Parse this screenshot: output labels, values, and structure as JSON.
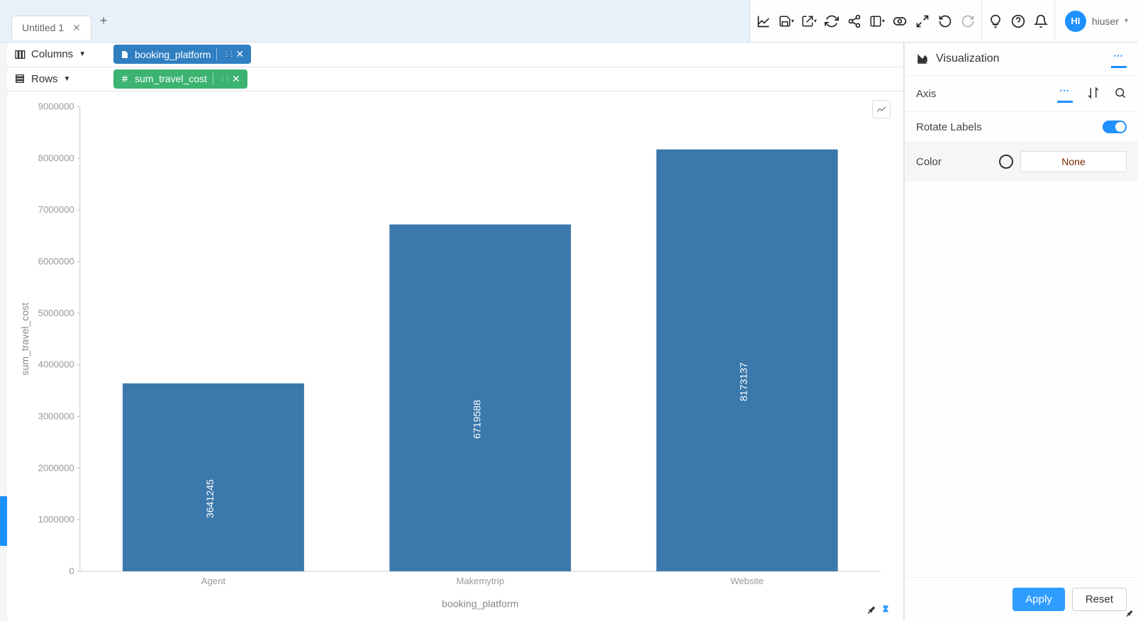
{
  "tab": {
    "title": "Untitled 1"
  },
  "user": {
    "initials": "HI",
    "name": "hiuser"
  },
  "shelves": {
    "columns_label": "Columns",
    "rows_label": "Rows",
    "column_pill": "booking_platform",
    "row_pill": "sum_travel_cost"
  },
  "viz_panel": {
    "title": "Visualization",
    "axis_label": "Axis",
    "rotate_label": "Rotate Labels",
    "color_label": "Color",
    "color_value": "None",
    "apply": "Apply",
    "reset": "Reset"
  },
  "chart_data": {
    "type": "bar",
    "categories": [
      "Agent",
      "Makemytrip",
      "Website"
    ],
    "values": [
      3641245,
      6719588,
      8173137
    ],
    "xlabel": "booking_platform",
    "ylabel": "sum_travel_cost",
    "ylim": [
      0,
      9000000
    ],
    "yticks": [
      0,
      1000000,
      2000000,
      3000000,
      4000000,
      5000000,
      6000000,
      7000000,
      8000000,
      9000000
    ]
  }
}
